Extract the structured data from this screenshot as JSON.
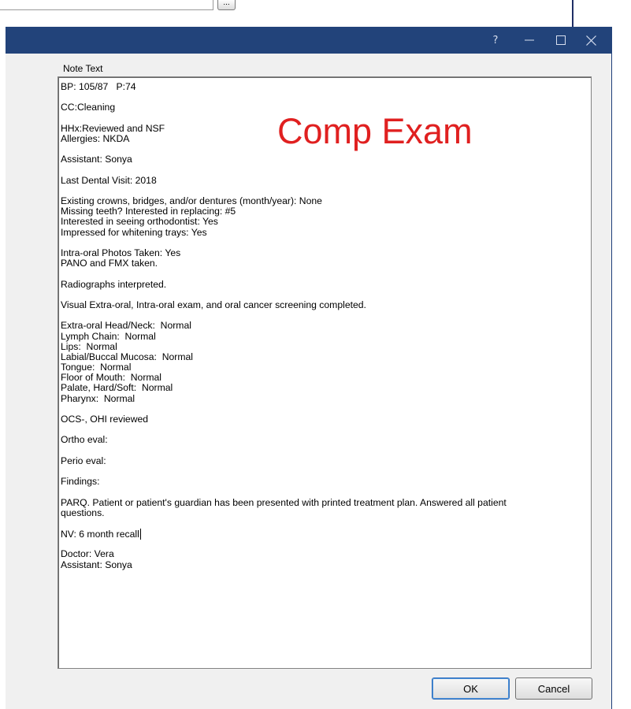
{
  "background": {
    "ellipsis_button_label": "...",
    "navigation_arrow_icon": "right-arrow-icon"
  },
  "dialog": {
    "title_buttons": {
      "help": "?",
      "minimize_icon": "minimize-icon",
      "maximize_icon": "maximize-icon",
      "close_icon": "close-icon"
    },
    "note_label": "Note Text",
    "overlay_text": "Comp Exam",
    "overlay_color": "#e02020",
    "note_lines": [
      "BP: 105/87   P:74",
      "",
      "CC:Cleaning",
      "",
      "HHx:Reviewed and NSF",
      "Allergies: NKDA",
      "",
      "Assistant: Sonya",
      "",
      "Last Dental Visit: 2018",
      "",
      "Existing crowns, bridges, and/or dentures (month/year): None",
      "Missing teeth? Interested in replacing: #5",
      "Interested in seeing orthodontist: Yes",
      "Impressed for whitening trays: Yes",
      "",
      "Intra-oral Photos Taken: Yes",
      "PANO and FMX taken.",
      "",
      "Radiographs interpreted.",
      "",
      "Visual Extra-oral, Intra-oral exam, and oral cancer screening completed.",
      "",
      "Extra-oral Head/Neck:  Normal",
      "Lymph Chain:  Normal",
      "Lips:  Normal",
      "Labial/Buccal Mucosa:  Normal",
      "Tongue:  Normal",
      "Floor of Mouth:  Normal",
      "Palate, Hard/Soft:  Normal",
      "Pharynx:  Normal",
      "",
      "OCS-, OHI reviewed",
      "",
      "Ortho eval:",
      "",
      "Perio eval:",
      "",
      "Findings:",
      "",
      "PARQ. Patient or patient's guardian has been presented with printed treatment plan. Answered all patient",
      "questions.",
      "",
      "NV: 6 month recall",
      "",
      "Doctor: Vera",
      "Assistant: Sonya"
    ],
    "buttons": {
      "ok": "OK",
      "cancel": "Cancel"
    }
  }
}
